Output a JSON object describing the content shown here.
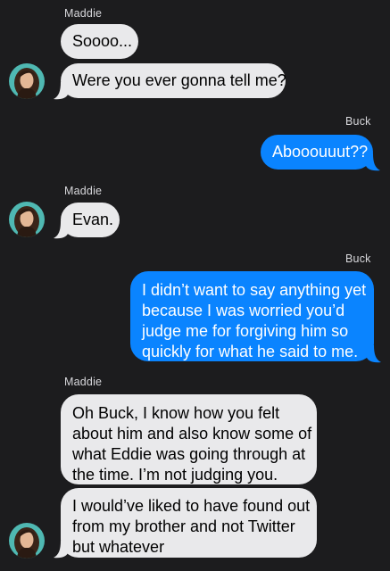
{
  "colors": {
    "background": "#1c1c1e",
    "incoming_bubble": "#e9e9eb",
    "outgoing_bubble": "#0a84ff",
    "sender_label": "#d8d8dc"
  },
  "conversation": {
    "messages": [
      {
        "sender": "Maddie",
        "direction": "incoming",
        "lines": [
          "Soooo..."
        ]
      },
      {
        "direction": "incoming",
        "lines": [
          "Were you ever gonna tell me?"
        ]
      },
      {
        "sender": "Buck",
        "direction": "outgoing",
        "lines": [
          "Abooouuut??"
        ]
      },
      {
        "sender": "Maddie",
        "direction": "incoming",
        "lines": [
          "Evan."
        ]
      },
      {
        "sender": "Buck",
        "direction": "outgoing",
        "lines": [
          "I didn’t want to say anything yet",
          "because I was worried you’d",
          "judge me for forgiving him so",
          "quickly for what he said to me."
        ]
      },
      {
        "sender": "Maddie",
        "direction": "incoming",
        "lines": [
          "Oh Buck, I know how you felt",
          "about him and also know some of",
          "what Eddie was going through at",
          "the time. I’m not judging you."
        ]
      },
      {
        "direction": "incoming",
        "lines": [
          "I would’ve liked to have found out",
          "from my brother and not Twitter",
          "but whatever"
        ]
      }
    ]
  }
}
